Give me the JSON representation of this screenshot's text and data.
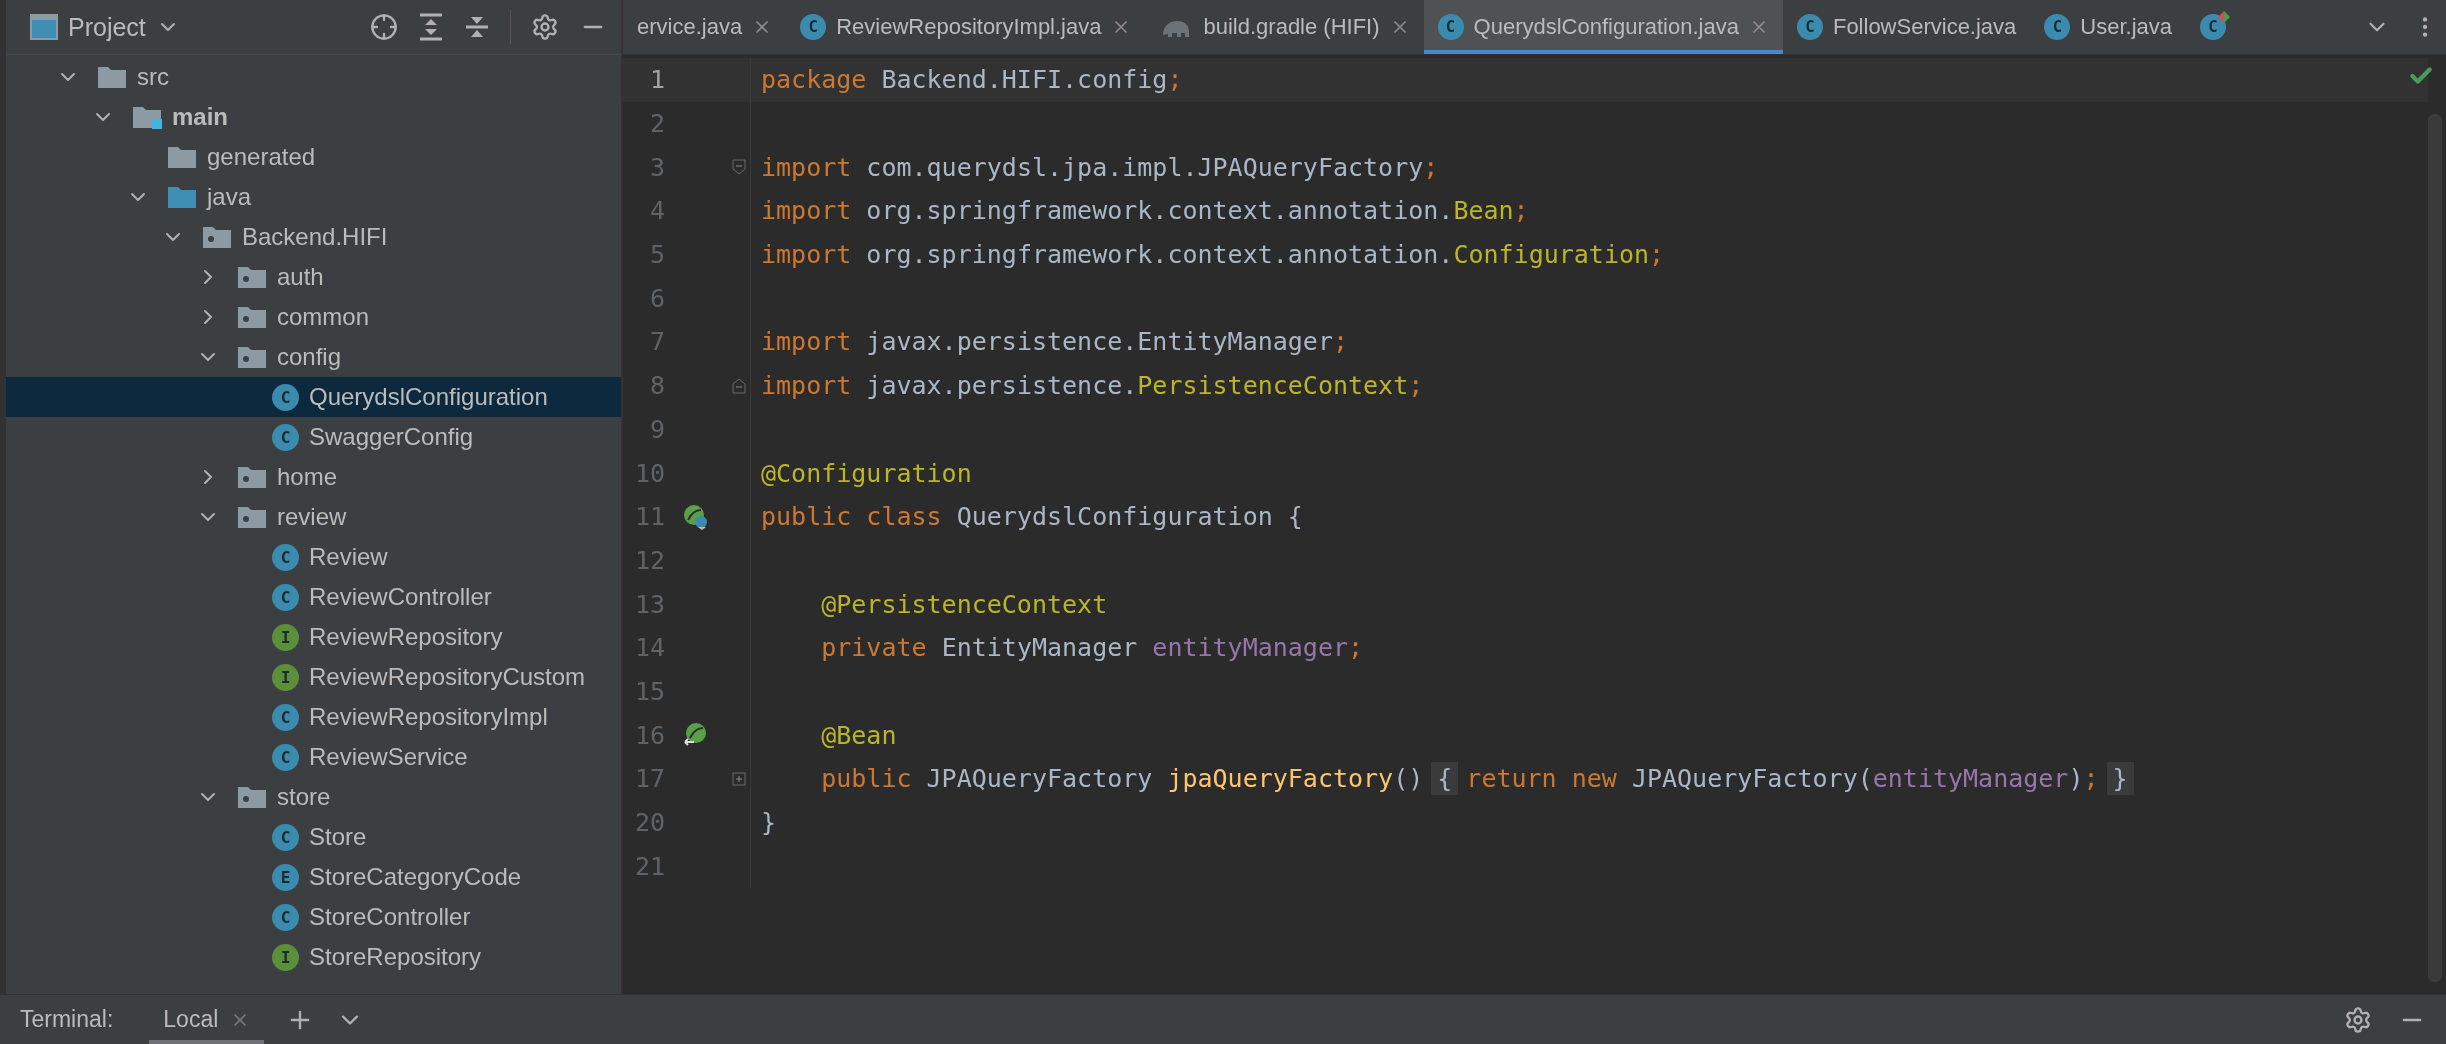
{
  "project_panel": {
    "title": "Project",
    "tree": [
      {
        "label": "src",
        "kind": "folder",
        "expanded": true,
        "selected": false,
        "children": [
          {
            "label": "main",
            "kind": "source-root",
            "expanded": true,
            "selected": false,
            "children": [
              {
                "label": "generated",
                "kind": "folder",
                "selected": false
              },
              {
                "label": "java",
                "kind": "source-folder",
                "expanded": true,
                "selected": false,
                "children": [
                  {
                    "label": "Backend.HIFI",
                    "kind": "package",
                    "expanded": true,
                    "selected": false,
                    "children": [
                      {
                        "label": "auth",
                        "kind": "package",
                        "expanded": false,
                        "selected": false
                      },
                      {
                        "label": "common",
                        "kind": "package",
                        "expanded": false,
                        "selected": false
                      },
                      {
                        "label": "config",
                        "kind": "package",
                        "expanded": true,
                        "selected": false,
                        "children": [
                          {
                            "label": "QuerydslConfiguration",
                            "kind": "class",
                            "badge": "C",
                            "selected": true
                          },
                          {
                            "label": "SwaggerConfig",
                            "kind": "class",
                            "badge": "C",
                            "selected": false
                          }
                        ]
                      },
                      {
                        "label": "home",
                        "kind": "package",
                        "expanded": false,
                        "selected": false
                      },
                      {
                        "label": "review",
                        "kind": "package",
                        "expanded": true,
                        "selected": false,
                        "children": [
                          {
                            "label": "Review",
                            "kind": "class",
                            "badge": "C",
                            "selected": false
                          },
                          {
                            "label": "ReviewController",
                            "kind": "class",
                            "badge": "C",
                            "selected": false
                          },
                          {
                            "label": "ReviewRepository",
                            "kind": "interface",
                            "badge": "I",
                            "selected": false
                          },
                          {
                            "label": "ReviewRepositoryCustom",
                            "kind": "interface",
                            "badge": "I",
                            "selected": false
                          },
                          {
                            "label": "ReviewRepositoryImpl",
                            "kind": "class",
                            "badge": "C",
                            "selected": false
                          },
                          {
                            "label": "ReviewService",
                            "kind": "class",
                            "badge": "C",
                            "selected": false
                          }
                        ]
                      },
                      {
                        "label": "store",
                        "kind": "package",
                        "expanded": true,
                        "selected": false,
                        "children": [
                          {
                            "label": "Store",
                            "kind": "class",
                            "badge": "C",
                            "selected": false
                          },
                          {
                            "label": "StoreCategoryCode",
                            "kind": "enum",
                            "badge": "E",
                            "selected": false
                          },
                          {
                            "label": "StoreController",
                            "kind": "class",
                            "badge": "C",
                            "selected": false
                          },
                          {
                            "label": "StoreRepository",
                            "kind": "interface",
                            "badge": "I",
                            "selected": false
                          }
                        ]
                      }
                    ]
                  }
                ]
              }
            ]
          }
        ]
      }
    ]
  },
  "editor_tabs": [
    {
      "label": "ervice.java",
      "close_button": true,
      "selected": false
    },
    {
      "label": "ReviewRepositoryImpl.java",
      "kind": "class",
      "badge": "C",
      "close_button": true,
      "selected": false
    },
    {
      "label": "build.gradle (HIFI)",
      "kind": "gradle",
      "close_button": true,
      "selected": false
    },
    {
      "label": "QuerydslConfiguration.java",
      "kind": "class",
      "badge": "C",
      "close_button": true,
      "selected": true
    },
    {
      "label": "FollowService.java",
      "kind": "class",
      "badge": "C",
      "close_button": false,
      "selected": false
    },
    {
      "label": "User.java",
      "kind": "class",
      "badge": "C",
      "close_button": false,
      "selected": false
    },
    {
      "kind": "class-modified",
      "badge": "C",
      "close_button": false,
      "selected": false
    }
  ],
  "editor": {
    "lines": [
      {
        "n": "1",
        "current": true,
        "tokens": [
          {
            "t": "package",
            "kind": "keyword"
          },
          {
            "t": " Backend.HIFI.config",
            "kind": "plain"
          },
          {
            "t": ";",
            "kind": "punct"
          }
        ]
      },
      {
        "n": "2",
        "current": false
      },
      {
        "n": "3",
        "current": false,
        "fold_marker": {
          "kind": "start"
        },
        "tokens": [
          {
            "t": "import",
            "kind": "keyword"
          },
          {
            "t": " com.querydsl.jpa.impl.JPAQueryFactory",
            "kind": "plain"
          },
          {
            "t": ";",
            "kind": "punct"
          }
        ]
      },
      {
        "n": "4",
        "current": false,
        "tokens": [
          {
            "t": "import",
            "kind": "keyword"
          },
          {
            "t": " org.springframework.context.annotation.",
            "kind": "plain"
          },
          {
            "t": "Bean",
            "kind": "annotation"
          },
          {
            "t": ";",
            "kind": "punct"
          }
        ]
      },
      {
        "n": "5",
        "current": false,
        "tokens": [
          {
            "t": "import",
            "kind": "keyword"
          },
          {
            "t": " org.springframework.context.annotation.",
            "kind": "plain"
          },
          {
            "t": "Configuration",
            "kind": "annotation"
          },
          {
            "t": ";",
            "kind": "punct"
          }
        ]
      },
      {
        "n": "6",
        "current": false
      },
      {
        "n": "7",
        "current": false,
        "tokens": [
          {
            "t": "import",
            "kind": "keyword"
          },
          {
            "t": " javax.persistence.EntityManager",
            "kind": "plain"
          },
          {
            "t": ";",
            "kind": "punct"
          }
        ]
      },
      {
        "n": "8",
        "current": false,
        "fold_marker": {
          "kind": "end"
        },
        "tokens": [
          {
            "t": "import",
            "kind": "keyword"
          },
          {
            "t": " javax.persistence.",
            "kind": "plain"
          },
          {
            "t": "PersistenceContext",
            "kind": "annotation"
          },
          {
            "t": ";",
            "kind": "punct"
          }
        ]
      },
      {
        "n": "9",
        "current": false
      },
      {
        "n": "10",
        "current": false,
        "tokens": [
          {
            "t": "@Configuration",
            "kind": "annotation"
          }
        ]
      },
      {
        "n": "11",
        "current": false,
        "gutter_icon": {
          "kind": "class-bean"
        },
        "tokens": [
          {
            "t": "public class ",
            "kind": "keyword"
          },
          {
            "t": "QuerydslConfiguration {",
            "kind": "plain"
          }
        ]
      },
      {
        "n": "12",
        "current": false
      },
      {
        "n": "13",
        "current": false,
        "tokens": [
          {
            "t": "    @PersistenceContext",
            "kind": "annotation"
          }
        ]
      },
      {
        "n": "14",
        "current": false,
        "tokens": [
          {
            "t": "    private",
            "kind": "keyword"
          },
          {
            "t": " EntityManager ",
            "kind": "plain"
          },
          {
            "t": "entityManager",
            "kind": "field"
          },
          {
            "t": ";",
            "kind": "punct"
          }
        ]
      },
      {
        "n": "15",
        "current": false
      },
      {
        "n": "16",
        "current": false,
        "gutter_icon": {
          "kind": "method-bean"
        },
        "tokens": [
          {
            "t": "    @Bean",
            "kind": "annotation"
          }
        ]
      },
      {
        "n": "17",
        "current": false,
        "fold_marker": {
          "kind": "folded"
        },
        "tokens": [
          {
            "t": "    public",
            "kind": "keyword"
          },
          {
            "t": " JPAQueryFactory ",
            "kind": "plain"
          },
          {
            "t": "jpaQueryFactory",
            "kind": "method"
          },
          {
            "t": "()",
            "kind": "plain"
          },
          {
            "t": "{",
            "kind": "folded"
          },
          {
            "t": "return new",
            "kind": "keyword"
          },
          {
            "t": " JPAQueryFactory(",
            "kind": "plain"
          },
          {
            "t": "entityManager",
            "kind": "field"
          },
          {
            "t": ")",
            "kind": "plain"
          },
          {
            "t": ";",
            "kind": "punct"
          },
          {
            "t": "}",
            "kind": "folded"
          }
        ]
      },
      {
        "n": "20",
        "current": false,
        "tokens": [
          {
            "t": "}",
            "kind": "plain"
          }
        ]
      },
      {
        "n": "21",
        "current": false
      }
    ]
  },
  "terminal_bar": {
    "title": "Terminal:",
    "tabs": [
      {
        "label": "Local",
        "selected": true
      }
    ]
  }
}
